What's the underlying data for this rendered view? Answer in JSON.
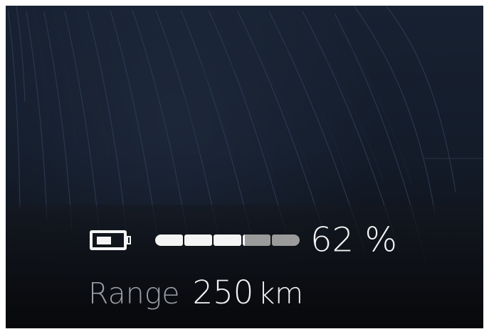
{
  "battery": {
    "level_fraction": 0.62,
    "percent_value": "62",
    "percent_unit": "%",
    "percent_text": "62 %",
    "icon": "battery-icon",
    "filled_color": "#f4f4f4",
    "partial_color": "#9b9b9b",
    "empty_color": "#5f6165"
  },
  "range": {
    "label": "Range",
    "value": "250",
    "unit": "km"
  },
  "colors": {
    "background": "#141c2a",
    "primary_text": "#f4f4f4",
    "secondary_text": "#9a9ea5",
    "line_color": "#2c3c53"
  }
}
